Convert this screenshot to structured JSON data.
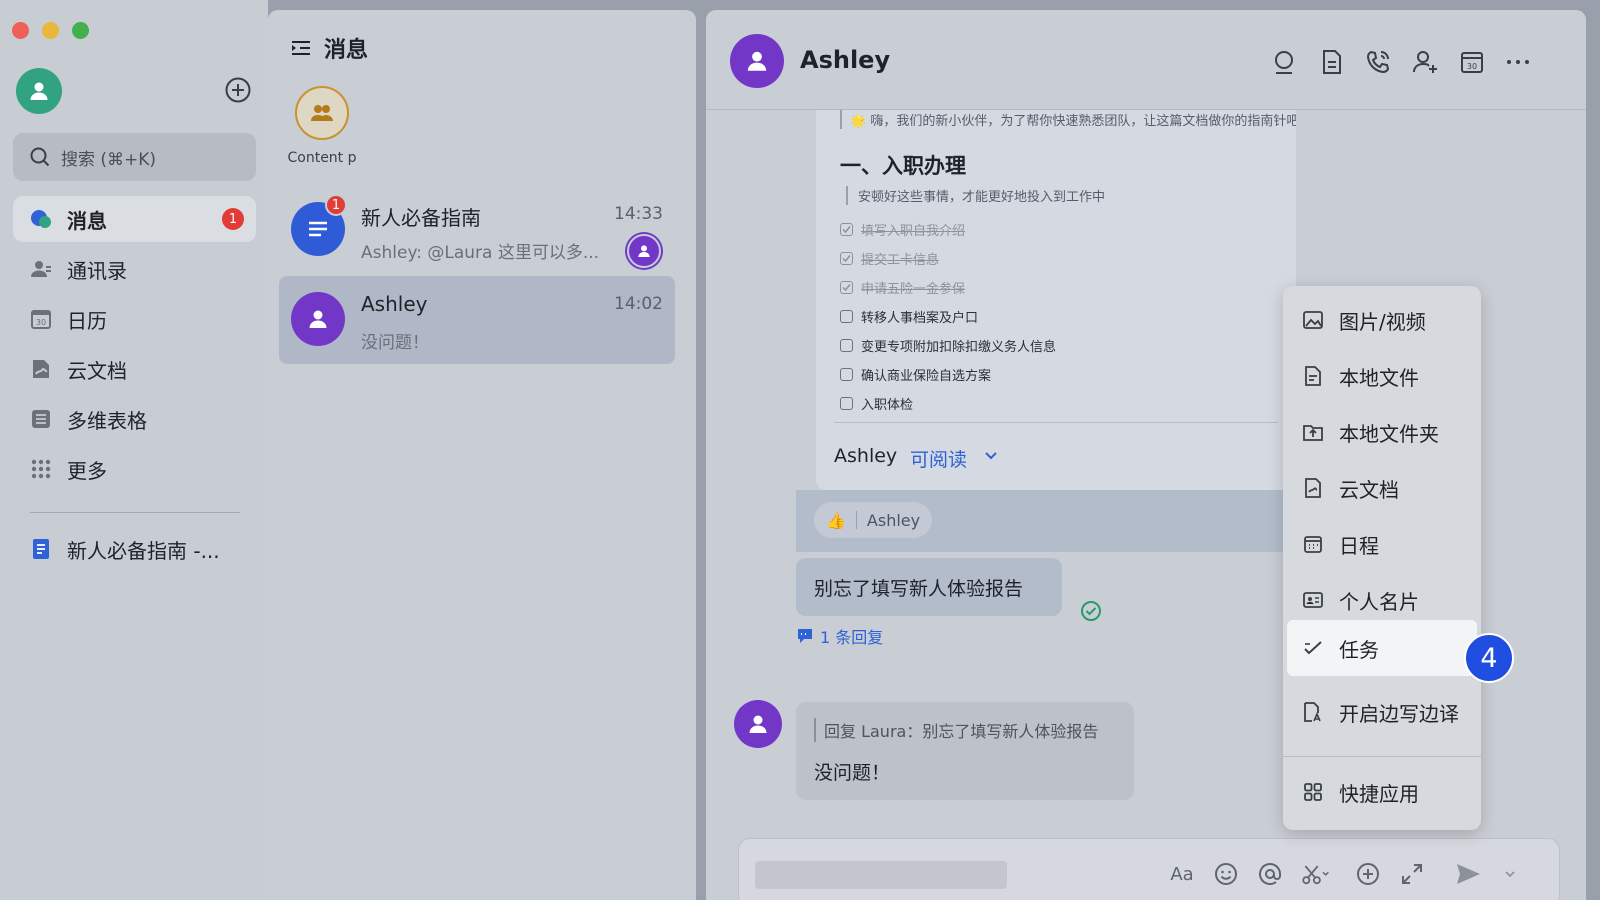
{
  "sidebar": {
    "search_placeholder": "搜索 (⌘+K)",
    "nav": [
      {
        "label": "消息",
        "badge": "1"
      },
      {
        "label": "通讯录"
      },
      {
        "label": "日历",
        "icon_text": "30"
      },
      {
        "label": "云文档"
      },
      {
        "label": "多维表格"
      },
      {
        "label": "更多"
      }
    ],
    "pinned_doc": "新人必备指南 -..."
  },
  "chatlist": {
    "title": "消息",
    "pinned": {
      "label": "Content p"
    },
    "conversations": [
      {
        "name": "新人必备指南",
        "time": "14:33",
        "preview": "Ashley: @Laura 这里可以多...",
        "badge": "1"
      },
      {
        "name": "Ashley",
        "time": "14:02",
        "preview": "没问题！"
      }
    ]
  },
  "chat": {
    "header_name": "Ashley",
    "doc_card": {
      "intro": "🌟 嗨，我们的新小伙伴，为了帮你快速熟悉团队，让这篇文档做你的指南针吧！",
      "heading": "一、入职办理",
      "quote": "安顿好这些事情，才能更好地投入到工作中",
      "checklist": [
        {
          "text": "填写入职自我介绍",
          "done": true
        },
        {
          "text": "提交工卡信息",
          "done": true
        },
        {
          "text": "申请五险一金参保",
          "done": true
        },
        {
          "text": "转移人事档案及户口",
          "done": false
        },
        {
          "text": "变更专项附加扣除扣缴义务人信息",
          "done": false
        },
        {
          "text": "确认商业保险自选方案",
          "done": false
        },
        {
          "text": "入职体检",
          "done": false
        }
      ],
      "owner": "Ashley",
      "permission": "可阅读"
    },
    "reaction": {
      "emoji": "👍",
      "user": "Ashley"
    },
    "outgoing_message": "别忘了填写新人体验报告",
    "reply_count": "1 条回复",
    "incoming": {
      "quote": "回复 Laura：别忘了填写新人体验报告",
      "body": "没问题！"
    },
    "composer": {
      "font_icon_label": "Aa"
    }
  },
  "attach_menu": {
    "items": [
      {
        "label": "图片/视频"
      },
      {
        "label": "本地文件"
      },
      {
        "label": "本地文件夹"
      },
      {
        "label": "云文档"
      },
      {
        "label": "日程"
      },
      {
        "label": "个人名片"
      },
      {
        "label": "任务"
      },
      {
        "label": "开启边写边译"
      },
      {
        "label": "快捷应用"
      }
    ]
  },
  "step_badge": "4",
  "colors": {
    "accent_blue": "#2f62d6",
    "avatar_purple": "#7337c8",
    "badge_red": "#e23c39",
    "step_badge_blue": "#1f4ee0",
    "self_avatar_green": "#31a381"
  }
}
